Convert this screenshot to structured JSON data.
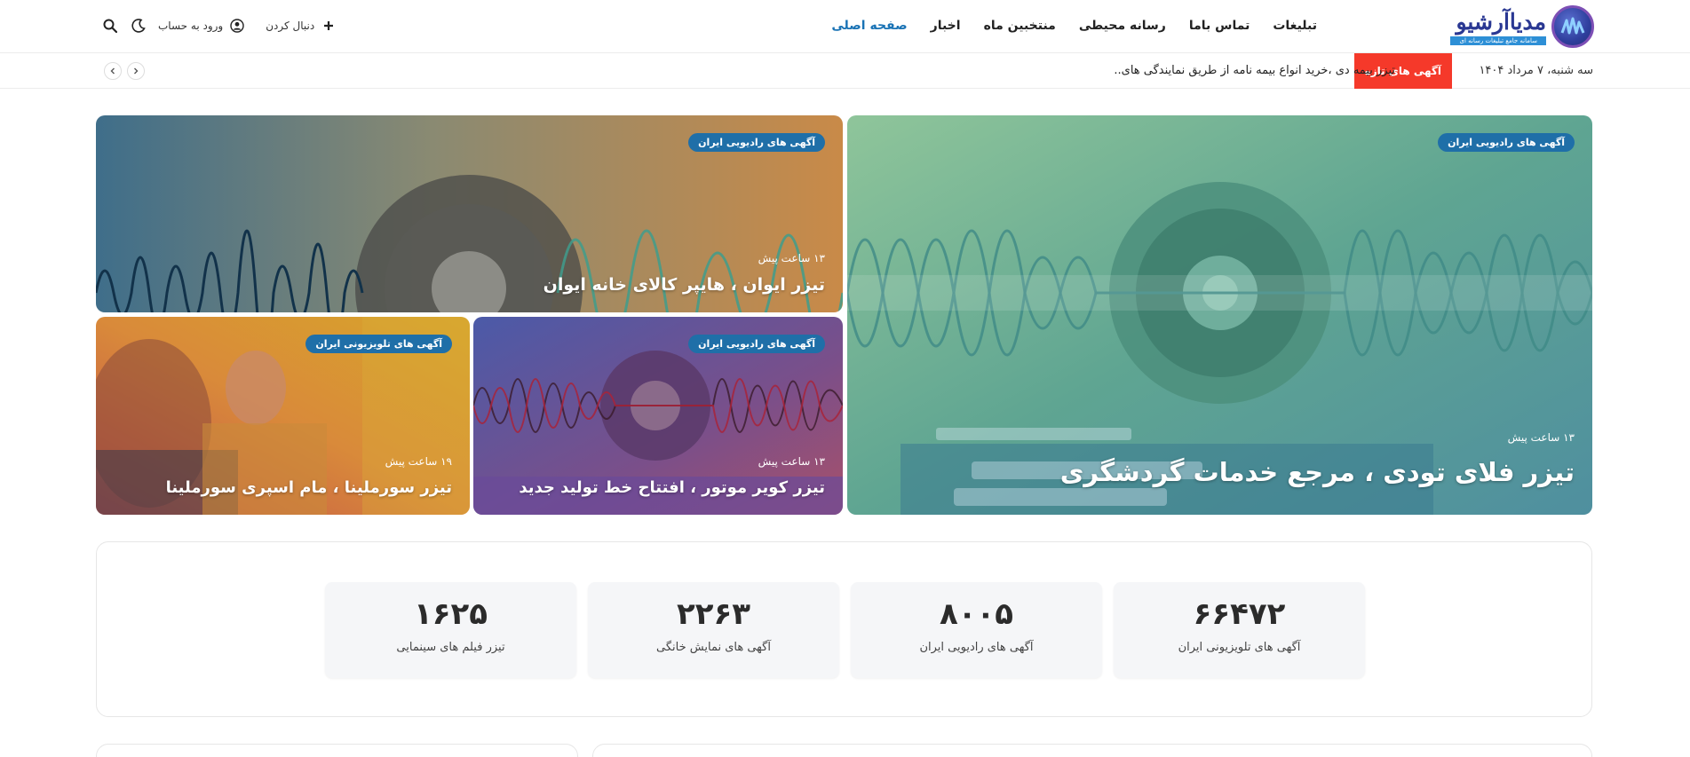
{
  "header": {
    "logo_title": "مدیاآرشیو",
    "logo_subtitle": "سامانه جامع تبلیغات رسانه ای",
    "nav": [
      {
        "label": "صفحه اصلی",
        "active": true
      },
      {
        "label": "اخبار"
      },
      {
        "label": "منتخبین ماه"
      },
      {
        "label": "رسانه محیطی"
      },
      {
        "label": "تماس باما"
      },
      {
        "label": "تبلیغات"
      }
    ],
    "login_label": "ورود به حساب",
    "follow_label": "دنبال کردن",
    "icons": [
      "search-icon",
      "moon-icon",
      "user-icon",
      "plus-icon"
    ]
  },
  "ticker": {
    "date": "سه شنبه، ۷ مرداد ۱۴۰۴",
    "label": "آگهی های تازه",
    "headline": "تیزر بیمه دی ،خرید انواع بیمه نامه از طریق نمایندگی های..",
    "accent_color": "#f5392a"
  },
  "featured": {
    "main": {
      "badge": "آگهی های رادیویی ایران",
      "time": "۱۳ ساعت پیش",
      "title": "تیزر فلای تودی ، مرجع خدمات گردشگری"
    },
    "top": {
      "badge": "آگهی های رادیویی ایران",
      "time": "۱۳ ساعت پیش",
      "title": "تیزر ایوان ، هایپر کالای خانه ایوان"
    },
    "mid": {
      "badge": "آگهی های رادیویی ایران",
      "time": "۱۳ ساعت پیش",
      "title": "تیزر کویر موتور ، افتتاح خط تولید جدید"
    },
    "left": {
      "badge": "آگهی های تلویزیونی ایران",
      "time": "۱۹ ساعت پیش",
      "title": "تیزر سورملینا ، مام اسپری سورملینا"
    },
    "badge_color": "#1f6fa8"
  },
  "stats": [
    {
      "value": "۶۶۴۷۲",
      "label": "آگهی های تلویزیونی ایران"
    },
    {
      "value": "۸۰۰۵",
      "label": "آگهی های رادیویی ایران"
    },
    {
      "value": "۲۲۶۳",
      "label": "آگهی های نمایش خانگی"
    },
    {
      "value": "۱۶۲۵",
      "label": "تیزر فیلم های سینمایی"
    }
  ]
}
